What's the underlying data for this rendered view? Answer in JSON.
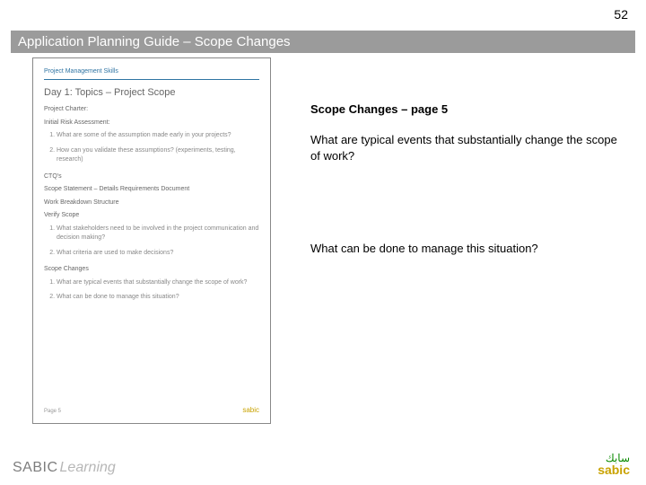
{
  "page_number": "52",
  "title_bar": "Application Planning Guide – Scope Changes",
  "right": {
    "heading": "Scope Changes – page 5",
    "question1": "What are typical events that substantially change the scope of work?",
    "question2": "What can be done to manage this situation?"
  },
  "preview": {
    "header": "Project Management Skills",
    "day_title": "Day 1: Topics – Project Scope",
    "charter": "Project Charter:",
    "ira": "Initial Risk Assessment:",
    "q1": "What are some of the assumption made early in your projects?",
    "q2": "How can you validate these assumptions? (experiments, testing, research)",
    "ctq": "CTQ's",
    "scope_stmt": "Scope Statement – Details Requirements Document",
    "wbs": "Work Breakdown Structure",
    "verify": "Verify Scope",
    "vq1": "What stakeholders need to be involved in the project communication and decision making?",
    "vq2": "What criteria are used to make decisions?",
    "scope_changes": "Scope Changes",
    "sc1": "What are typical events that substantially change the scope of work?",
    "sc2": "What can be done to manage this situation?",
    "page_label": "Page 5"
  },
  "footer": {
    "brand_left_a": "SABIC",
    "brand_left_b": "Learning",
    "brand_right_ar": "سابك",
    "brand_right_en": "sabic"
  }
}
